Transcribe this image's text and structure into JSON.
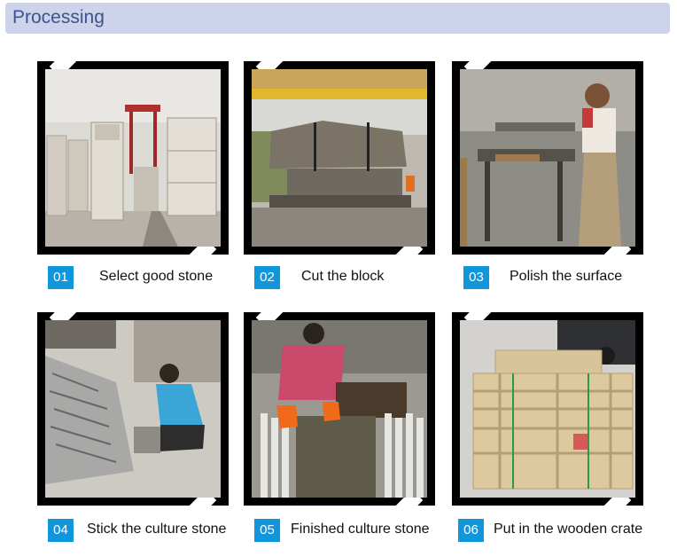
{
  "header": {
    "title": "Processing"
  },
  "colors": {
    "header_bg": "#ccd3ea",
    "header_text": "#41518f",
    "step_badge": "#1296db",
    "card_frame": "#000000"
  },
  "steps": [
    {
      "number": "01",
      "label": "Select good stone",
      "photo": "stone-blocks-quarry-photo"
    },
    {
      "number": "02",
      "label": "Cut the block",
      "photo": "block-cutting-machine-photo"
    },
    {
      "number": "03",
      "label": "Polish the surface",
      "photo": "worker-polishing-photo"
    },
    {
      "number": "04",
      "label": "Stick the culture stone",
      "photo": "worker-sticking-stone-photo"
    },
    {
      "number": "05",
      "label": "Finished culture stone",
      "photo": "finished-culture-stone-photo"
    },
    {
      "number": "06",
      "label": "Put in the wooden crate",
      "photo": "wooden-crates-photo"
    }
  ]
}
